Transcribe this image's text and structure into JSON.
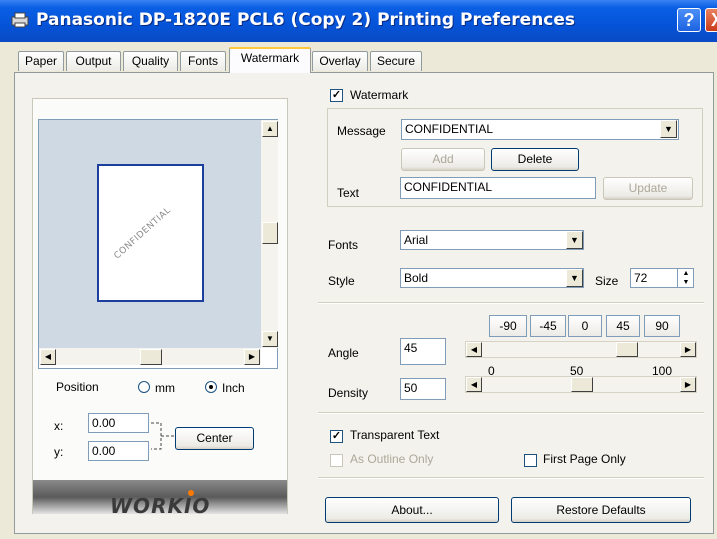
{
  "window": {
    "title": "Panasonic DP-1820E PCL6 (Copy 2) Printing Preferences",
    "help_label": "?",
    "close_label": "X"
  },
  "tabs": [
    "Paper",
    "Output",
    "Quality",
    "Fonts",
    "Watermark",
    "Overlay",
    "Secure"
  ],
  "active_tab": "Watermark",
  "preview": {
    "watermark_text": "CONFIDENTIAL"
  },
  "position": {
    "label": "Position",
    "unit_mm": "mm",
    "unit_inch": "Inch",
    "selected_unit": "Inch",
    "x_label": "x:",
    "x_value": "0.00",
    "y_label": "y:",
    "y_value": "0.00",
    "center_label": "Center"
  },
  "brand": {
    "logo": "WORKIO"
  },
  "watermark": {
    "enabled_label": "Watermark",
    "enabled": true,
    "message_label": "Message",
    "message_value": "CONFIDENTIAL",
    "add_label": "Add",
    "delete_label": "Delete",
    "text_label": "Text",
    "text_value": "CONFIDENTIAL",
    "update_label": "Update",
    "fonts_label": "Fonts",
    "fonts_value": "Arial",
    "style_label": "Style",
    "style_value": "Bold",
    "size_label": "Size",
    "size_value": "72",
    "angle_presets": [
      "-90",
      "-45",
      "0",
      "45",
      "90"
    ],
    "angle_label": "Angle",
    "angle_value": "45",
    "density_label": "Density",
    "density_value": "50",
    "scale_labels": [
      "0",
      "50",
      "100"
    ],
    "transparent_label": "Transparent Text",
    "transparent": true,
    "outline_label": "As Outline Only",
    "outline": false,
    "first_page_label": "First Page Only",
    "first_page": false
  },
  "buttons": {
    "about": "About...",
    "restore": "Restore Defaults"
  },
  "arrows": {
    "up": "▲",
    "down": "▼",
    "left": "◀",
    "right": "▶",
    "check": "✓"
  }
}
